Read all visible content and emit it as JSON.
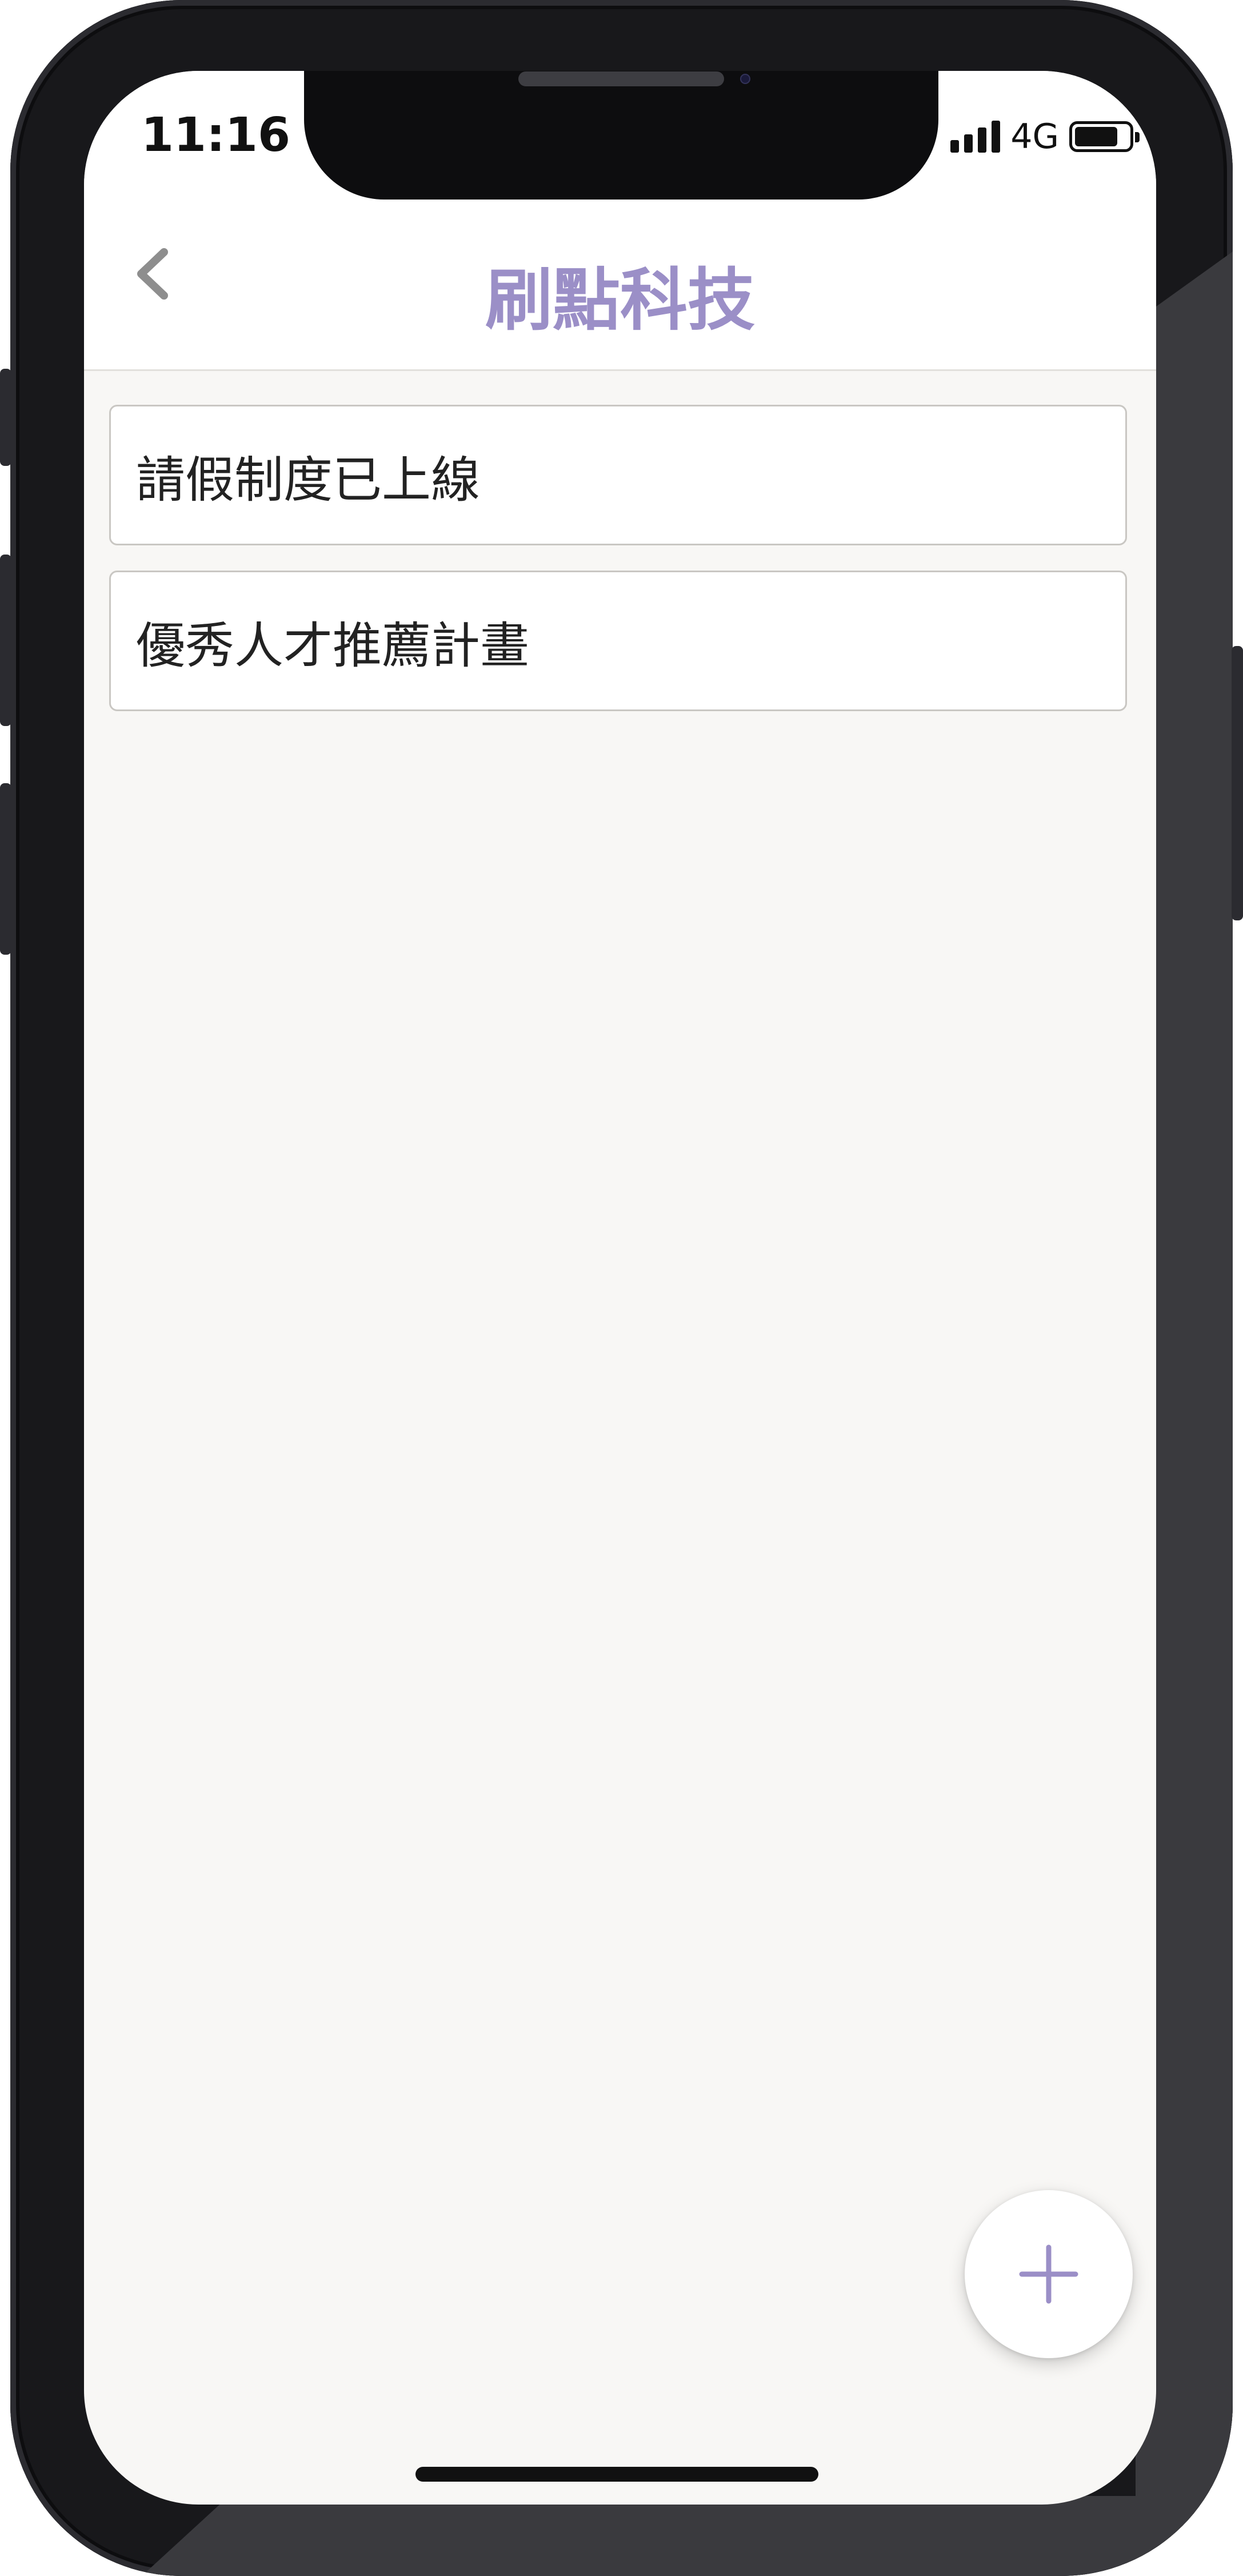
{
  "status_bar": {
    "time": "11:16",
    "network": "4G",
    "battery_level": 0.8
  },
  "header": {
    "title": "刷點科技",
    "back_icon": "chevron-left-icon"
  },
  "list": {
    "items": [
      {
        "label": "請假制度已上線"
      },
      {
        "label": "優秀人才推薦計畫"
      }
    ]
  },
  "fab": {
    "icon": "plus-icon"
  },
  "colors": {
    "accent": "#9b8fc7",
    "background": "#f8f7f5",
    "card_border": "#c9c7c3",
    "text": "#222222"
  }
}
